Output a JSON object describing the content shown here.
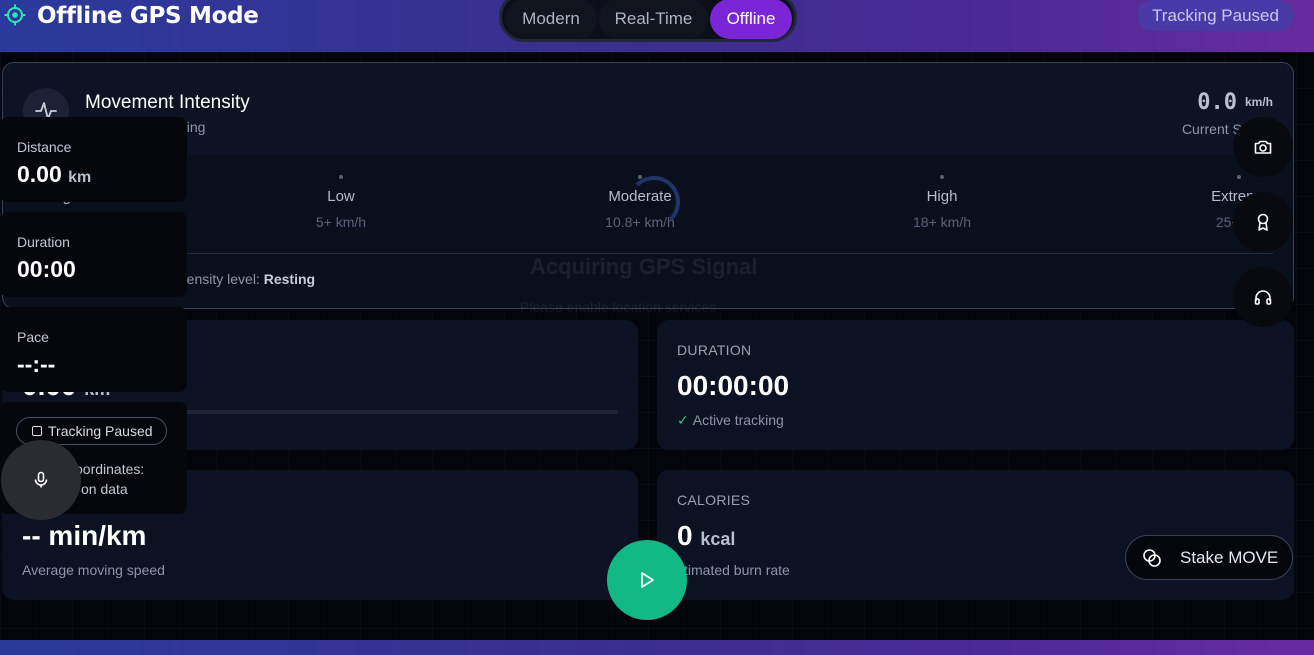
{
  "header": {
    "title": "Offline GPS Mode",
    "modes": [
      {
        "label": "Modern",
        "active": false
      },
      {
        "label": "Real-Time",
        "active": false
      },
      {
        "label": "Offline",
        "active": true
      }
    ],
    "status": "Tracking Paused"
  },
  "intensity": {
    "title": "Movement Intensity",
    "subtitle_fragment": "ding",
    "speed_value": "0.0",
    "speed_unit": "km/h",
    "speed_label": "Current Speed",
    "levels": [
      {
        "name": "esting",
        "threshold": ""
      },
      {
        "name": "Low",
        "threshold": "5+ km/h"
      },
      {
        "name": "Moderate",
        "threshold": "10.8+ km/h"
      },
      {
        "name": "High",
        "threshold": "18+ km/h"
      },
      {
        "name": "Extreme",
        "threshold": "25+ km"
      }
    ],
    "status_prefix": "ntensity level: ",
    "status_value": "Resting"
  },
  "overlay": {
    "title_fragment": "Acquiring GPS Signal",
    "sub_fragment": "Please enable location services"
  },
  "cards": {
    "distance": {
      "value": "0.00",
      "unit": "km"
    },
    "duration": {
      "label": "DURATION",
      "value": "00:00:00",
      "sub": "Active tracking"
    },
    "pace": {
      "value": "-- min/km",
      "sub": "Average moving speed"
    },
    "calories": {
      "label": "CALORIES",
      "value": "0",
      "unit": "kcal",
      "sub": "stimated burn rate"
    }
  },
  "side_panel": {
    "distance_label": "Distance",
    "distance_value": "0.00",
    "distance_unit": "km",
    "duration_label": "Duration",
    "duration_value": "00:00",
    "pace_label": "Pace",
    "pace_value": "--:--",
    "pause_label": "Tracking Paused",
    "coord_line1": "oordinates:",
    "coord_line2": "on data"
  },
  "actions": {
    "stake_label": "Stake MOVE"
  },
  "colors": {
    "accent": "#7a26d6",
    "play": "#13b985",
    "success": "#2ec28a"
  }
}
